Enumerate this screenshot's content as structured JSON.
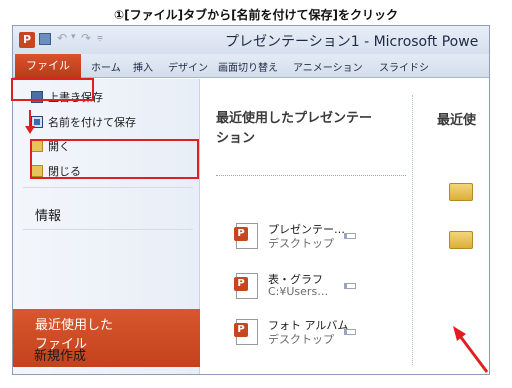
{
  "annotation": {
    "caption": "①[ファイル]タブから[名前を付けて保存]をクリック",
    "highlight_color": "#e02020"
  },
  "titlebar": {
    "app_icon_letter": "P",
    "title": "プレゼンテーション1 - Microsoft Powe"
  },
  "ribbon": {
    "file_tab": "ファイル",
    "tabs": [
      "ホーム",
      "挿入",
      "デザイン",
      "画面切り替え",
      "アニメーション",
      "スライドシ"
    ]
  },
  "backstage": {
    "commands": [
      {
        "label": "上書き保存",
        "icon": "save-icon"
      },
      {
        "label": "名前を付けて保存",
        "icon": "save-as-icon"
      },
      {
        "label": "開く",
        "icon": "open-folder-icon"
      },
      {
        "label": "閉じる",
        "icon": "close-folder-icon"
      }
    ],
    "sections": {
      "info": "情報",
      "recent_line1": "最近使用した",
      "recent_line2": "ファイル",
      "new": "新規作成"
    },
    "recent_presentations": {
      "title_line1": "最近使用したプレゼンテー",
      "title_line2": "ション",
      "files": [
        {
          "name": "プレゼンテー…",
          "path": "デスクトップ"
        },
        {
          "name": "表・グラフ",
          "path": "C:¥Users…"
        },
        {
          "name": "フォト アルバム",
          "path": "デスクトップ"
        }
      ]
    },
    "recent_places": {
      "title": "最近使"
    }
  },
  "colors": {
    "file_tab": "#c8461f",
    "selected_section": "#d04d25",
    "ribbon": "#dce4f0"
  }
}
